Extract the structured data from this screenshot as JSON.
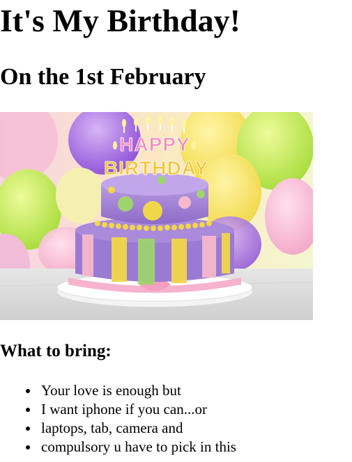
{
  "page": {
    "heading": "It's My Birthday!",
    "date_heading": "On the 1st February"
  },
  "cake_image": {
    "candle_letters_top": "HAPPY",
    "candle_letters_bottom": "BIRTHDAY"
  },
  "bring_section": {
    "heading": "What to bring:",
    "items": [
      "Your love is enough but",
      "I want iphone if you can...or",
      "laptops, tab, camera and",
      "compulsory u have to pick in this"
    ]
  },
  "colors": {
    "text": "#000000",
    "background": "#ffffff",
    "cake_purple": "#9b7fd0",
    "cake_pink": "#f5b8c8",
    "cake_yellow": "#f0d43a",
    "cake_green": "#9ccf6a"
  }
}
